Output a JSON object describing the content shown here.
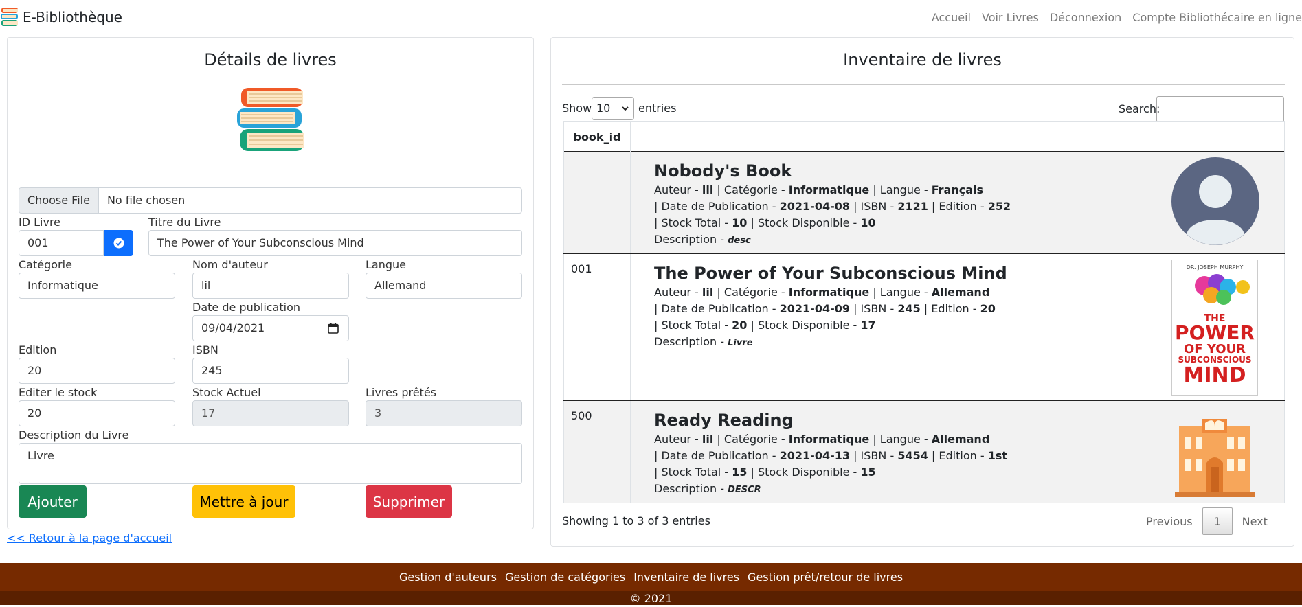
{
  "brand": {
    "name": "E-Bibliothèque",
    "icon": "books-stack-icon"
  },
  "nav": [
    "Accueil",
    "Voir Livres",
    "Déconnexion",
    "Compte Bibliothécaire en ligne"
  ],
  "details": {
    "title": "Détails de livres",
    "file_button": "Choose File",
    "file_status": "No file chosen",
    "id_label": "ID Livre",
    "id_value": "001",
    "titre_label": "Titre du Livre",
    "titre_value": "The Power of Your Subconscious Mind",
    "categorie_label": "Catégorie",
    "categorie_value": "Informatique",
    "auteur_label": "Nom d'auteur",
    "auteur_value": "lil",
    "langue_label": "Langue",
    "langue_value": "Allemand",
    "date_label": "Date de publication",
    "date_value": "09/04/2021",
    "edition_label": "Edition",
    "edition_value": "20",
    "isbn_label": "ISBN",
    "isbn_value": "245",
    "stock_edit_label": "Editer le stock",
    "stock_edit_value": "20",
    "stock_actuel_label": "Stock Actuel",
    "stock_actuel_value": "17",
    "pretes_label": "Livres prêtés",
    "pretes_value": "3",
    "desc_label": "Description du Livre",
    "desc_value": "Livre",
    "btn_add": "Ajouter",
    "btn_update": "Mettre à jour",
    "btn_delete": "Supprimer"
  },
  "back_link": "<< Retour à la page d'accueil",
  "inventory": {
    "title": "Inventaire de livres",
    "show_label": "Show",
    "show_value": "10",
    "entries_label": "entries",
    "search_label": "Search:",
    "col_header": "book_id",
    "rows": [
      {
        "id": "",
        "title": "Nobody's Book",
        "l1": {
          "a": "Auteur - ",
          "auteur": "lil",
          "b": " |  Catégorie - ",
          "cat": "Informatique",
          "c": "  | Langue -  ",
          "langue": "Français"
        },
        "l2": {
          "a": " | Date de Publication - ",
          "date": "2021-04-08",
          "b": "  | ISBN - ",
          "isbn": "2121",
          "c": "  | Edition - ",
          "edition": "252"
        },
        "l3": {
          "a": " | Stock Total - ",
          "total": "10",
          "b": "  | Stock Disponible - ",
          "dispo": "10"
        },
        "l4": {
          "a": "Description - ",
          "desc": "desc"
        },
        "image": "avatar-placeholder-icon"
      },
      {
        "id": "001",
        "title": "The Power of Your Subconscious Mind",
        "l1": {
          "a": "Auteur - ",
          "auteur": "lil",
          "b": " |  Catégorie - ",
          "cat": "Informatique",
          "c": "  | Langue -  ",
          "langue": "Allemand"
        },
        "l2": {
          "a": " | Date de Publication - ",
          "date": "2021-04-09",
          "b": "  | ISBN - ",
          "isbn": "245",
          "c": "  | Edition - ",
          "edition": "20"
        },
        "l3": {
          "a": " | Stock Total - ",
          "total": "20",
          "b": "  | Stock Disponible - ",
          "dispo": "17"
        },
        "l4": {
          "a": "Description - ",
          "desc": "Livre"
        },
        "image": "book-cover-icon",
        "cover": {
          "author": "DR. JOSEPH MURPHY",
          "t1": "THE",
          "t2": "POWER",
          "t3": "OF YOUR",
          "t4": "SUBCONSCIOUS",
          "t5": "MIND"
        }
      },
      {
        "id": "500",
        "title": "Ready Reading",
        "l1": {
          "a": "Auteur - ",
          "auteur": "lil",
          "b": " |  Catégorie - ",
          "cat": "Informatique",
          "c": "  | Langue -  ",
          "langue": "Allemand"
        },
        "l2": {
          "a": " | Date de Publication - ",
          "date": "2021-04-13",
          "b": "  | ISBN - ",
          "isbn": "5454",
          "c": "  | Edition - ",
          "edition": "1st"
        },
        "l3": {
          "a": " | Stock Total - ",
          "total": "15",
          "b": "  | Stock Disponible - ",
          "dispo": "15"
        },
        "l4": {
          "a": "Description - ",
          "desc": "DESCR"
        },
        "image": "library-building-icon"
      }
    ],
    "info": "Showing 1 to 3 of 3 entries",
    "prev": "Previous",
    "page": "1",
    "next": "Next"
  },
  "footer": {
    "links": [
      "Gestion d'auteurs",
      "Gestion de catégories",
      "Inventaire de livres",
      "Gestion prêt/retour de livres"
    ],
    "copyright": "© 2021"
  },
  "colors": {
    "primary": "#0d6efd",
    "success": "#198754",
    "warning": "#ffc107",
    "danger": "#dc3545",
    "footer": "#762a00",
    "footer_dark": "#5a2000"
  }
}
